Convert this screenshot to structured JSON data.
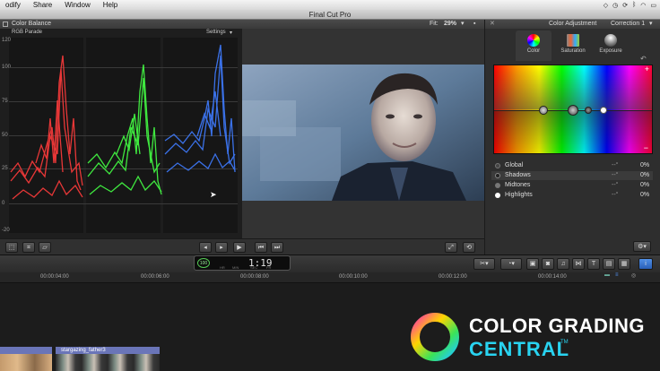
{
  "menubar": {
    "items": [
      "odify",
      "Share",
      "Window",
      "Help"
    ]
  },
  "window": {
    "title": "Final Cut Pro"
  },
  "scope": {
    "title": "Color Balance",
    "mode": "RGB Parade",
    "settings": "Settings",
    "ticks": [
      "120",
      "100",
      "75",
      "50",
      "25",
      "0",
      "-20"
    ],
    "colors": {
      "red": "#ff3b3b",
      "green": "#44ff44",
      "blue": "#3f7bff"
    }
  },
  "viewer": {
    "fit_label": "Fit:",
    "fit_value": "29%"
  },
  "inspector": {
    "title": "Color Adjustment",
    "correction": "Correction 1",
    "tabs": [
      {
        "label": "Color"
      },
      {
        "label": "Saturation"
      },
      {
        "label": "Exposure"
      }
    ],
    "rows": [
      {
        "name": "Global",
        "deg": "--°",
        "pct": "0%"
      },
      {
        "name": "Shadows",
        "deg": "--°",
        "pct": "0%"
      },
      {
        "name": "Midtones",
        "deg": "--°",
        "pct": "0%"
      },
      {
        "name": "Highlights",
        "deg": "--°",
        "pct": "0%"
      }
    ]
  },
  "toolbar": {
    "percent": "100",
    "timecode": "1:19",
    "tc_labels": [
      "HR",
      "MIN",
      "SEC",
      "FR"
    ]
  },
  "ruler": {
    "marks": [
      "00:00:04:00",
      "00:00:06:00",
      "00:00:08:00",
      "00:00:10:00",
      "00:00:12:00",
      "00:00:14:00"
    ]
  },
  "clip": {
    "name": "stargazing_father3"
  },
  "logo": {
    "line1": "COLOR GRADING",
    "line2": "CENTRAL",
    "tm": "TM",
    "colors": {
      "line1": "#ffffff",
      "line2": "#29d3f0"
    }
  }
}
